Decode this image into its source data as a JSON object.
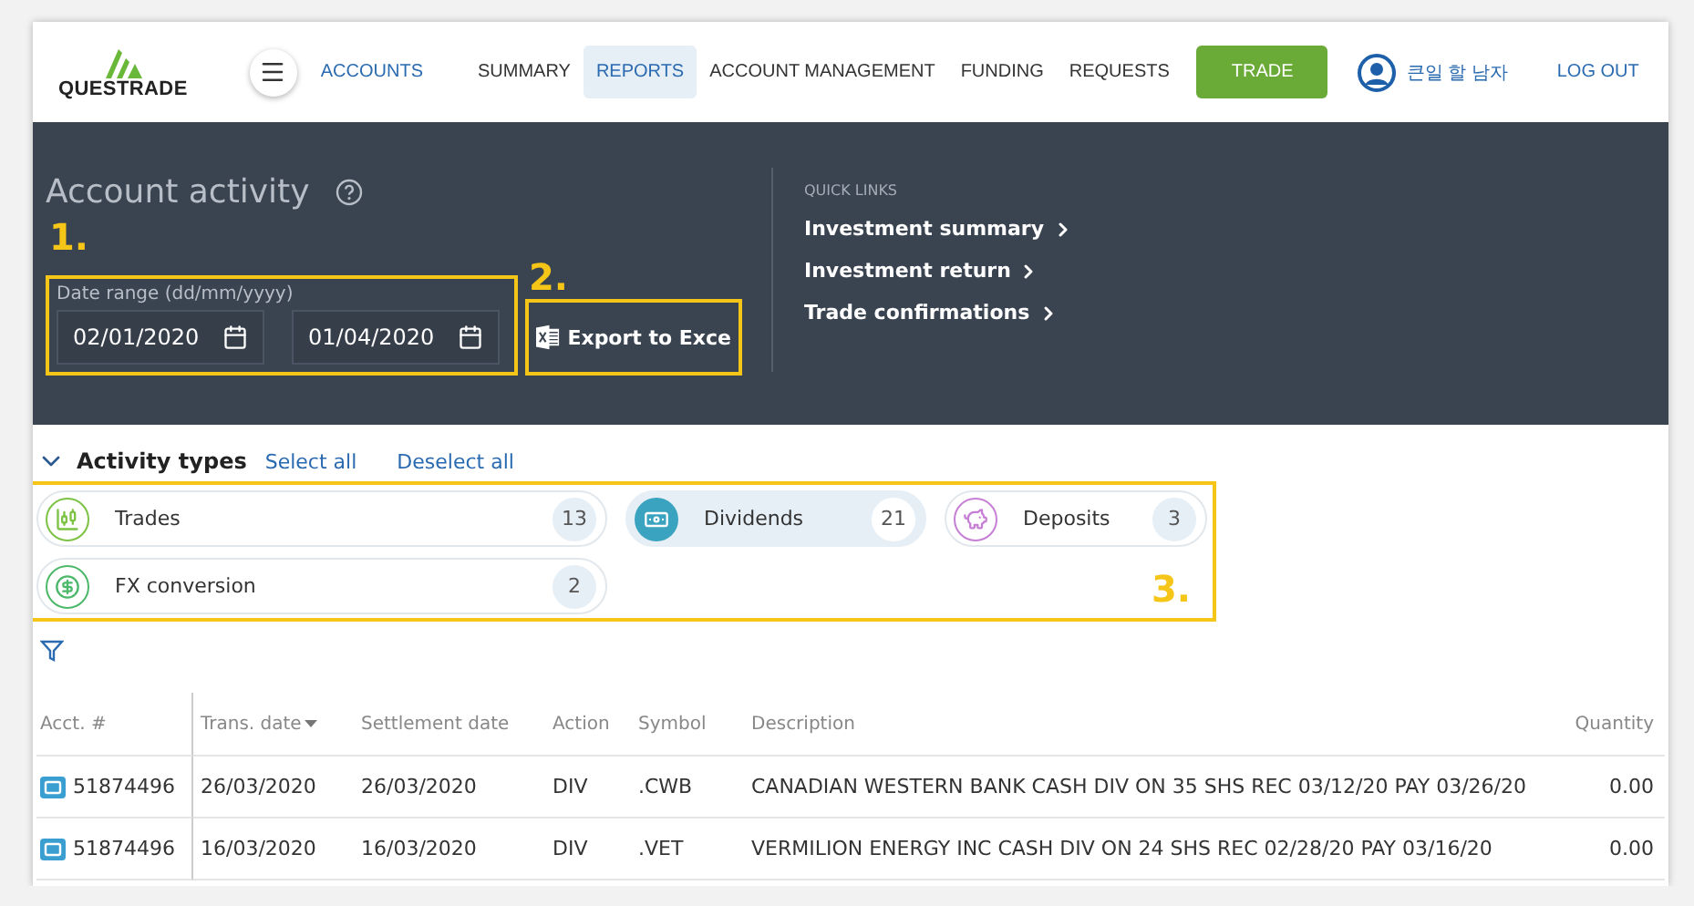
{
  "header": {
    "logo": "QUESTRADE",
    "menu_label": "ACCOUNTS",
    "nav": [
      {
        "label": "SUMMARY",
        "selected": false
      },
      {
        "label": "REPORTS",
        "selected": true
      },
      {
        "label": "ACCOUNT MANAGEMENT",
        "selected": false
      },
      {
        "label": "FUNDING",
        "selected": false
      },
      {
        "label": "REQUESTS",
        "selected": false
      }
    ],
    "trade_button": "TRADE",
    "user_name": "큰일 할 남자",
    "logout": "LOG OUT"
  },
  "activity": {
    "title": "Account activity",
    "date_label": "Date range (dd/mm/yyyy)",
    "start_date": "02/01/2020",
    "end_date": "01/04/2020",
    "export_button": "Export to Exce",
    "quick_links_title": "QUICK LINKS",
    "quick_links": [
      "Investment summary",
      "Investment return",
      "Trade confirmations"
    ]
  },
  "annotations": [
    "1.",
    "2.",
    "3."
  ],
  "activity_types": {
    "title": "Activity types",
    "select_all": "Select all",
    "deselect_all": "Deselect all",
    "items": [
      {
        "kind": "trades",
        "label": "Trades",
        "count": "13",
        "selected": false,
        "color": "#7cc243"
      },
      {
        "kind": "dividends",
        "label": "Dividends",
        "count": "21",
        "selected": true,
        "color": "#3aa3c0"
      },
      {
        "kind": "deposits",
        "label": "Deposits",
        "count": "3",
        "selected": false,
        "color": "#c77fd6"
      },
      {
        "kind": "fx",
        "label": "FX conversion",
        "count": "2",
        "selected": false,
        "color": "#4cb86a"
      }
    ]
  },
  "table": {
    "columns": [
      {
        "label": "Acct. #",
        "sorted": false
      },
      {
        "label": "Trans. date",
        "sorted": true
      },
      {
        "label": "Settlement date",
        "sorted": false
      },
      {
        "label": "Action",
        "sorted": false
      },
      {
        "label": "Symbol",
        "sorted": false
      },
      {
        "label": "Description",
        "sorted": false
      },
      {
        "label": "Quantity",
        "sorted": false
      }
    ],
    "rows": [
      [
        "51874496",
        "26/03/2020",
        "26/03/2020",
        "DIV",
        ".CWB",
        "CANADIAN WESTERN BANK CASH DIV ON 35 SHS REC 03/12/20 PAY 03/26/20",
        "0.00"
      ],
      [
        "51874496",
        "16/03/2020",
        "16/03/2020",
        "DIV",
        ".VET",
        "VERMILION ENERGY INC CASH DIV ON 24 SHS REC 02/28/20 PAY 03/16/20",
        "0.00"
      ]
    ]
  }
}
